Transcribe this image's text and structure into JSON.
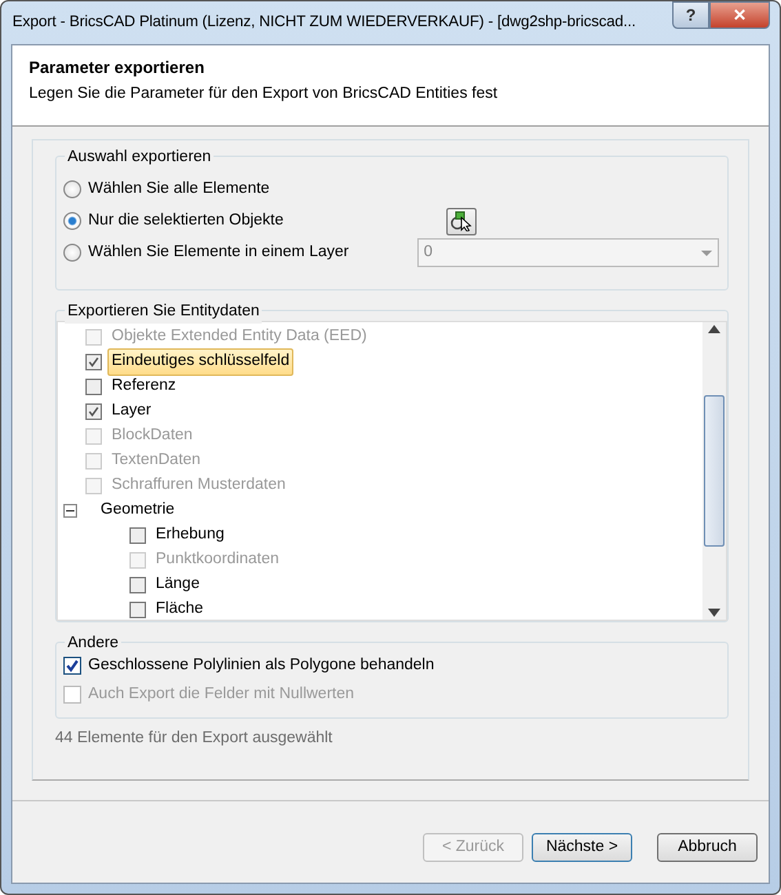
{
  "window": {
    "title": "Export - BricsCAD Platinum (Lizenz, NICHT ZUM WIEDERVERKAUF) - [dwg2shp-bricscad...",
    "help": "?",
    "close": "✕"
  },
  "header": {
    "title": "Parameter exportieren",
    "subtitle": "Legen Sie die Parameter für den Export von BricsCAD Entities fest"
  },
  "selection_group": {
    "title": "Auswahl exportieren",
    "options": [
      {
        "label": "Wählen Sie alle Elemente",
        "selected": false
      },
      {
        "label": "Nur die selektierten Objekte",
        "selected": true
      },
      {
        "label": "Wählen Sie Elemente in einem Layer",
        "selected": false
      }
    ],
    "layer_dropdown": {
      "value": "0",
      "disabled": true
    }
  },
  "entity_group": {
    "title": "Exportieren Sie Entitydaten",
    "items": [
      {
        "label": "Objekte Extended Entity Data (EED)",
        "checked": false,
        "disabled": true,
        "selected": false
      },
      {
        "label": "Eindeutiges schlüsselfeld",
        "checked": true,
        "disabled": false,
        "selected": true
      },
      {
        "label": "Referenz",
        "checked": false,
        "disabled": false,
        "selected": false
      },
      {
        "label": "Layer",
        "checked": true,
        "disabled": false,
        "selected": false
      },
      {
        "label": "BlockDaten",
        "checked": false,
        "disabled": true,
        "selected": false
      },
      {
        "label": "TextenDaten",
        "checked": false,
        "disabled": true,
        "selected": false
      },
      {
        "label": "Schraffuren Musterdaten",
        "checked": false,
        "disabled": true,
        "selected": false
      },
      {
        "label": "Geometrie",
        "expanded": true,
        "children": [
          {
            "label": "Erhebung",
            "checked": false,
            "disabled": false,
            "selected": false
          },
          {
            "label": "Punktkoordinaten",
            "checked": false,
            "disabled": true,
            "selected": false
          },
          {
            "label": "Länge",
            "checked": false,
            "disabled": false,
            "selected": false
          },
          {
            "label": "Fläche",
            "checked": false,
            "disabled": false,
            "selected": false
          }
        ]
      }
    ]
  },
  "other_group": {
    "title": "Andere",
    "options": [
      {
        "label": "Geschlossene Polylinien als Polygone behandeln",
        "checked": true,
        "disabled": false
      },
      {
        "label": "Auch Export die Felder mit Nullwerten",
        "checked": false,
        "disabled": true
      }
    ]
  },
  "status": "44 Elemente für den Export ausgewählt",
  "buttons": [
    {
      "label": "< Zurück",
      "disabled": true
    },
    {
      "label": "Nächste >",
      "disabled": false
    },
    {
      "label": "Abbruch",
      "disabled": false
    }
  ]
}
